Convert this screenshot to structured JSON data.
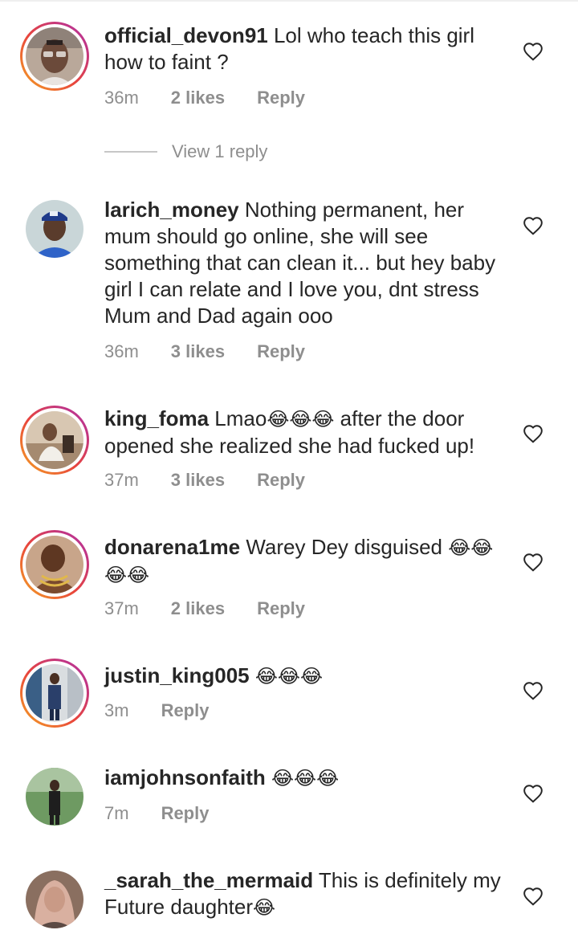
{
  "comments": [
    {
      "username": "official_devon91",
      "text": "Lol who teach this girl how to faint ?",
      "time": "36m",
      "likes": "2 likes",
      "reply": "Reply",
      "view_replies": "View 1 reply",
      "story_ring": true
    },
    {
      "username": "larich_money",
      "text": "Nothing permanent, her mum should go online, she will see something that can clean it... but hey baby girl I can relate and I love you, dnt stress Mum and Dad again ooo",
      "time": "36m",
      "likes": "3 likes",
      "reply": "Reply",
      "story_ring": false
    },
    {
      "username": "king_foma",
      "text_before": "Lmao",
      "emoji": "😂😂😂",
      "text_after": " after the door opened she realized she had fucked up!",
      "time": "37m",
      "likes": "3 likes",
      "reply": "Reply",
      "story_ring": true
    },
    {
      "username": "donarena1me",
      "text": "Warey Dey disguised",
      "emoji": "😂😂😂😂",
      "time": "37m",
      "likes": "2 likes",
      "reply": "Reply",
      "story_ring": true
    },
    {
      "username": "justin_king005",
      "emoji": "😂😂😂",
      "time": "3m",
      "reply": "Reply",
      "story_ring": true
    },
    {
      "username": "iamjohnsonfaith",
      "emoji": "😂😂😂",
      "time": "7m",
      "reply": "Reply",
      "story_ring": false
    },
    {
      "username": "_sarah_the_mermaid",
      "text": "This is definitely my Future daughter",
      "emoji": "😂",
      "story_ring": false
    }
  ],
  "icons": {
    "like": "heart-outline-icon"
  },
  "colors": {
    "text": "#262626",
    "muted": "#8e8e8e",
    "story_gradient_start": "#f5a623",
    "story_gradient_end": "#b83aa5"
  }
}
